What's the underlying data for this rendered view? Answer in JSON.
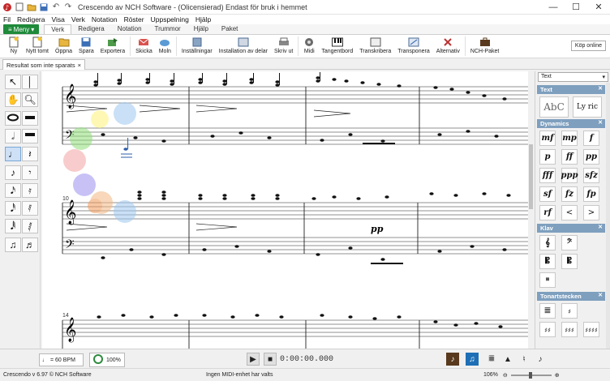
{
  "window": {
    "title": "Crescendo av NCH Software - (Olicensierad) Endast för bruk i hemmet"
  },
  "menu": [
    "Fil",
    "Redigera",
    "Visa",
    "Verk",
    "Notation",
    "Röster",
    "Uppspelning",
    "Hjälp"
  ],
  "tabs": {
    "meny": "Meny",
    "items": [
      "Verk",
      "Redigera",
      "Notation",
      "Trummor",
      "Hjälp",
      "Paket"
    ],
    "active": "Verk"
  },
  "toolbar": {
    "items": [
      {
        "label": "Ny",
        "icon": "new-doc-icon"
      },
      {
        "label": "Nytt tomt",
        "icon": "new-blank-icon"
      },
      {
        "label": "Öppna",
        "icon": "open-folder-icon"
      },
      {
        "label": "Spara",
        "icon": "save-icon"
      },
      {
        "label": "Exportera",
        "icon": "export-icon"
      },
      {
        "label": "Skicka",
        "icon": "send-icon"
      },
      {
        "label": "Moln",
        "icon": "cloud-icon"
      },
      {
        "label": "Inställningar",
        "icon": "settings-icon"
      },
      {
        "label": "Installation av delar",
        "icon": "parts-setup-icon"
      },
      {
        "label": "Skriv ut",
        "icon": "print-icon"
      },
      {
        "label": "Midi",
        "icon": "midi-icon"
      },
      {
        "label": "Tangentbord",
        "icon": "keyboard-icon"
      },
      {
        "label": "Transkribera",
        "icon": "transcribe-icon"
      },
      {
        "label": "Transponera",
        "icon": "transpose-icon"
      },
      {
        "label": "Alternativ",
        "icon": "tools-icon"
      },
      {
        "label": "NCH-Paket",
        "icon": "suitcase-icon"
      }
    ],
    "buy": "Köp online"
  },
  "document_tab": {
    "label": "Resultat som inte sparats",
    "close": "×"
  },
  "score": {
    "measure_numbers": [
      "10",
      "14"
    ],
    "dynamic_marking": "pp"
  },
  "right_panel": {
    "dropdown": "Text",
    "sections": {
      "text": "Text",
      "dynamics": "Dynamics",
      "clef": "Klav",
      "key": "Tonartstecken"
    },
    "text_buttons": [
      "AbC",
      "Ly ric"
    ],
    "dynamics": [
      "mf",
      "mp",
      "f",
      "p",
      "ff",
      "pp",
      "fff",
      "ppp",
      "sfz",
      "sf",
      "fz",
      "fp",
      "rf",
      "<",
      ">"
    ]
  },
  "transport": {
    "tempo": "= 60 BPM",
    "zoom": "100%",
    "time": "0:00:00.000"
  },
  "status": {
    "version": "Crescendo v 6.97 © NCH Software",
    "midi": "Ingen MIDI-enhet har valts",
    "zoom": "106%"
  },
  "colors": {
    "menu_green": "#1e8a3a",
    "panel_header": "#7e9fbe"
  }
}
